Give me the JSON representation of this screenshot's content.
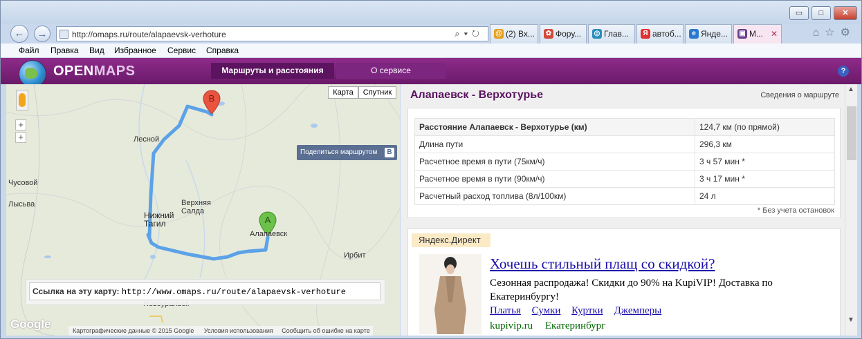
{
  "browser": {
    "window_controls": {
      "minimize": "▭",
      "maximize": "□",
      "close": "✕"
    },
    "back_icon": "back-arrow-icon",
    "forward_icon": "forward-arrow-icon",
    "address": "http://omaps.ru/route/alapaevsk-verhoture",
    "address_tools": "⌕▾↻",
    "tabs": [
      {
        "label": "(2) Вх...",
        "icon_color": "#e7a01d",
        "icon": "@"
      },
      {
        "label": "Фору...",
        "icon_color": "#d14a3a",
        "icon": "✿"
      },
      {
        "label": "Глав...",
        "icon_color": "#2a8dbf",
        "icon": "◎"
      },
      {
        "label": "автоб...",
        "icon_color": "#e03131",
        "icon": "Я"
      },
      {
        "label": "Янде...",
        "icon_color": "#2b78d0",
        "icon": "e"
      },
      {
        "label": "М...",
        "icon_color": "#6a3e8a",
        "icon": "▣"
      }
    ],
    "menu": [
      "Файл",
      "Правка",
      "Вид",
      "Избранное",
      "Сервис",
      "Справка"
    ],
    "right_icons": "⌂☆⚙"
  },
  "site": {
    "logo_open": "OPEN",
    "logo_maps": "MAPS",
    "nav": [
      "Маршруты и расстояния",
      "О сервисе"
    ],
    "help": "?"
  },
  "map": {
    "type_buttons": [
      "Карта",
      "Спутник"
    ],
    "zoom_in": "+",
    "zoom_out": "+",
    "share_label": "Поделиться маршрутом",
    "share_icon": "B",
    "marker_a": "A",
    "marker_b": "B",
    "labels": {
      "lesnoy": "Лесной",
      "chusovoy": "Чусовой",
      "lysva": "Лысьва",
      "nizhny_tagil_1": "Нижний",
      "nizhny_tagil_2": "Тагил",
      "verkhnyaya_salda_1": "Верхняя",
      "verkhnyaya_salda_2": "Салда",
      "alapaevsk": "Алапаевск",
      "irbit": "Ирбит",
      "novouralsk": "Новоуральск"
    },
    "link_label": "Ссылка на эту карту:",
    "link_value": "http://www.omaps.ru/route/alapaevsk-verhoture",
    "google_logo": "Google",
    "footer": [
      "Картографические данные © 2015 Google",
      "Условия использования",
      "Сообщить об ошибке на карте"
    ]
  },
  "route": {
    "title": "Алапаевск - Верхотурье",
    "details_link": "Сведения о маршруте",
    "rows": [
      {
        "key": "Расстояние Алапаевск - Верхотурье (км)",
        "value": "124,7 км (по прямой)"
      },
      {
        "key": "Длина пути",
        "value": "296,3 км"
      },
      {
        "key": "Расчетное время в пути (75км/ч)",
        "value": "3 ч 57 мин *"
      },
      {
        "key": "Расчетное время в пути (90км/ч)",
        "value": "3 ч 17 мин *"
      },
      {
        "key": "Расчетный расход топлива (8л/100км)",
        "value": "24 л"
      }
    ],
    "note": "* Без учета остановок"
  },
  "ad": {
    "tag": "Яндекс.Директ",
    "headline": "Хочешь стильный плащ со скидкой?",
    "text": "Сезонная распродажа! Скидки до 90% на KupiVIP! Доставка по Екатеринбургу!",
    "links": [
      "Платья",
      "Сумки",
      "Куртки",
      "Джемперы"
    ],
    "footer": [
      "kupivip.ru",
      "Екатеринбург"
    ]
  }
}
